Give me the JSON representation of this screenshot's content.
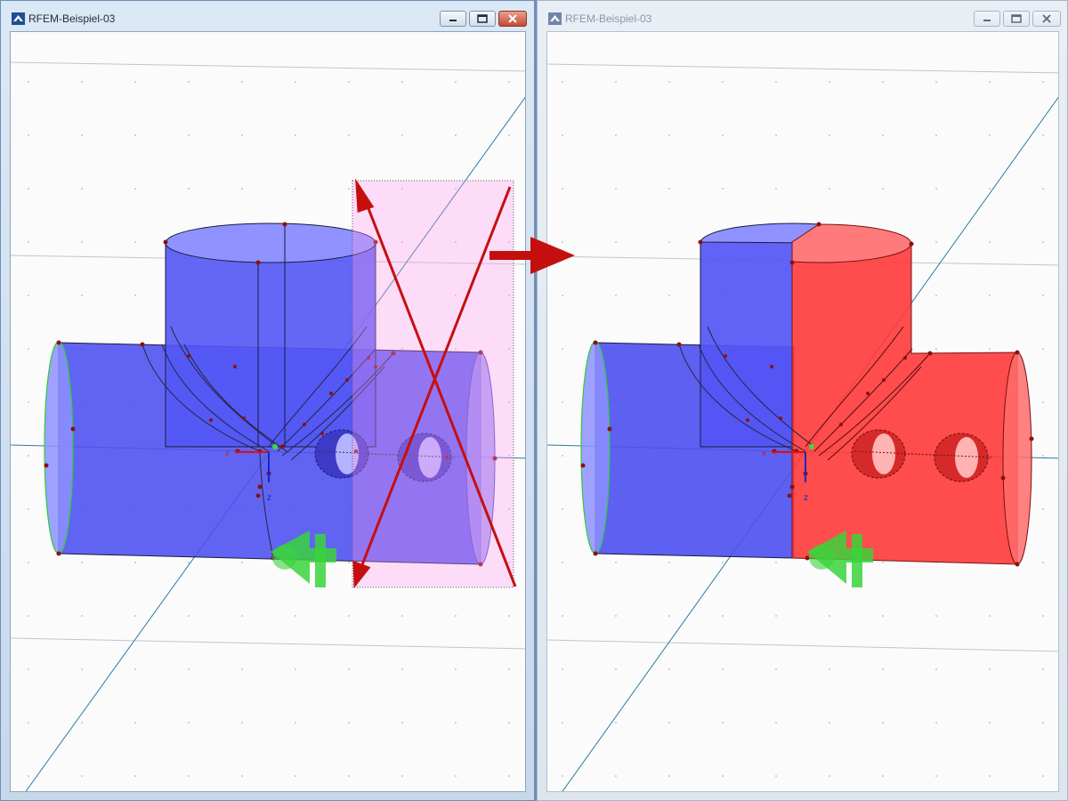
{
  "windows": [
    {
      "title": "RFEM-Beispiel-03",
      "state": "active"
    },
    {
      "title": "RFEM-Beispiel-03",
      "state": "inactive"
    }
  ],
  "axis_labels": {
    "x": "x",
    "z": "z"
  },
  "colors": {
    "model_blue": "#4b4ff0",
    "selected_red": "#ff3a3a",
    "window_rect": "#ff9cf0",
    "cross_arrow": "#c50f0f",
    "support_green": "#39d43c",
    "grid_line": "#2c7ba3"
  },
  "icons": [
    "rfem-app-icon",
    "minimize-icon",
    "maximize-icon",
    "close-icon",
    "right-arrow-icon"
  ]
}
